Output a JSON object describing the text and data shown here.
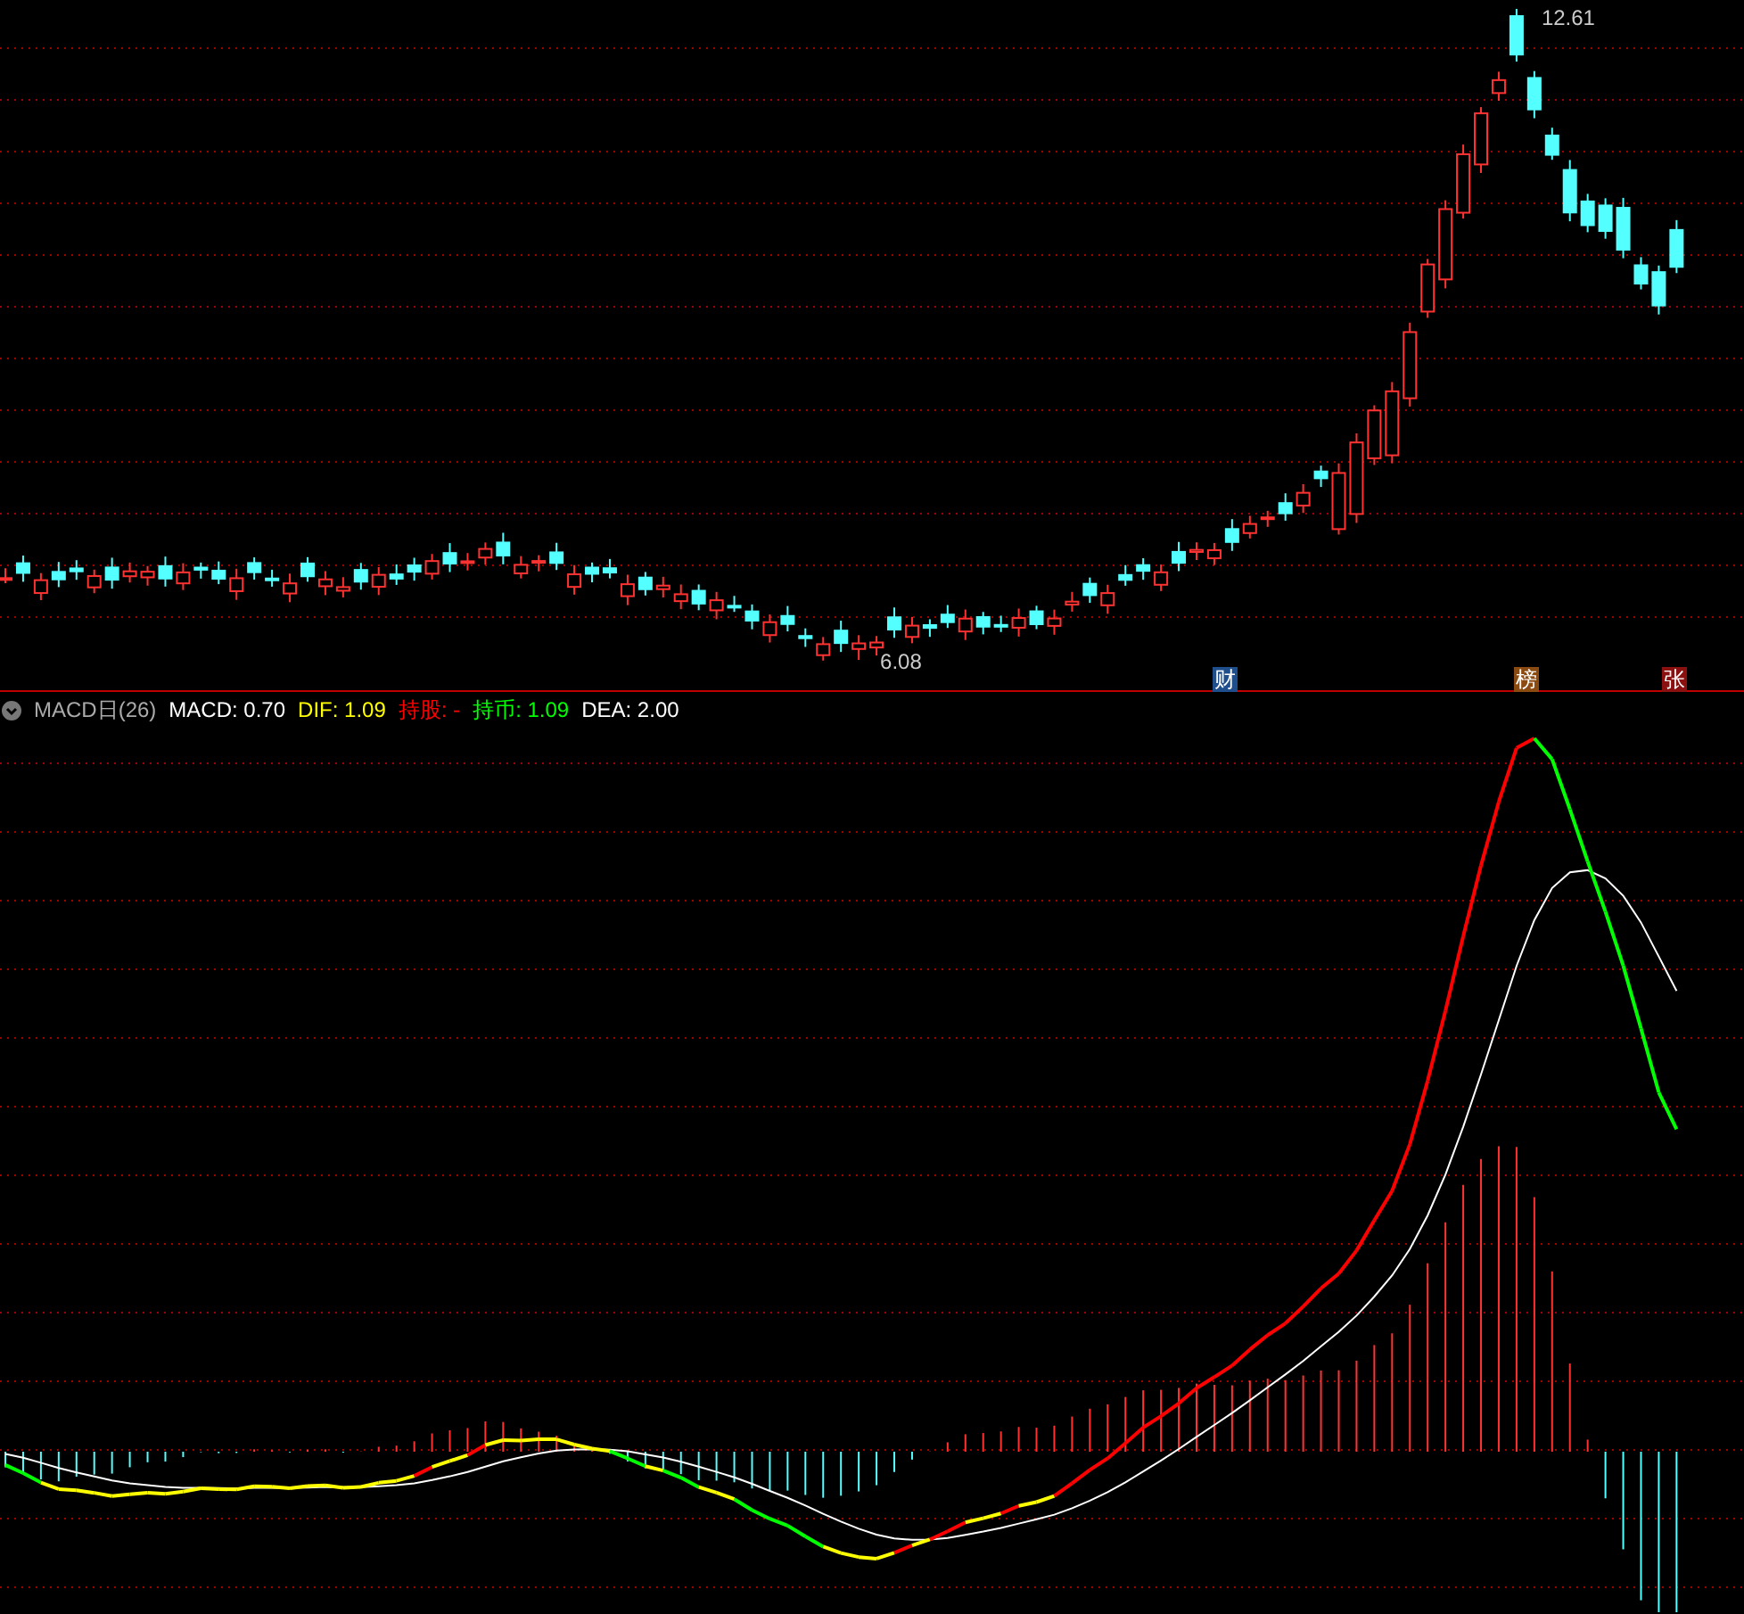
{
  "price_panel": {
    "high_label": "12.61",
    "low_label": "6.08",
    "event_tags": [
      {
        "text": "财",
        "color": "#1f4e8c"
      },
      {
        "text": "榜",
        "color": "#8b4a10"
      },
      {
        "text": "张",
        "color": "#8b1010"
      }
    ]
  },
  "indicator_header": {
    "name": "MACD日(26)",
    "values": [
      {
        "text": "MACD: 0.70",
        "color": "#ffffff"
      },
      {
        "text": "DIF: 1.09",
        "color": "#ffff00"
      },
      {
        "text": "持股: -",
        "color": "#ff0000"
      },
      {
        "text": "持币: 1.09",
        "color": "#00ff00"
      },
      {
        "text": "DEA: 2.00",
        "color": "#ffffff"
      }
    ]
  }
}
